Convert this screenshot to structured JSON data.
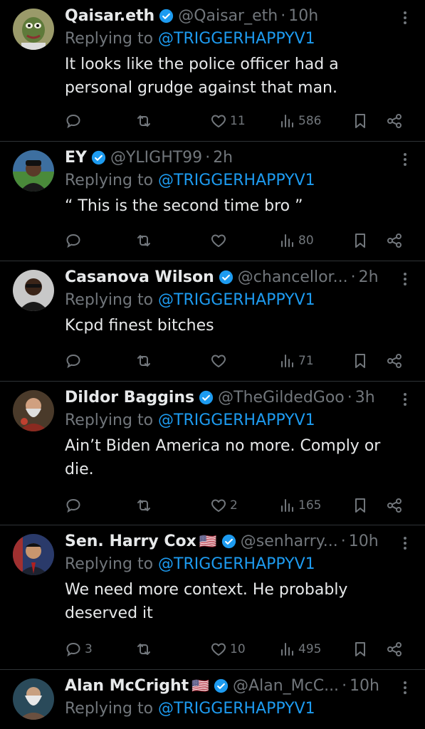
{
  "colors": {
    "background": "#000000",
    "text": "#e7e9ea",
    "muted": "#71767b",
    "accent": "#1d9bf0",
    "divider": "#2f3336"
  },
  "replying_prefix": "Replying to",
  "tweets": [
    {
      "name": "Qaisar.eth",
      "handle": "@Qaisar_eth",
      "time": "10h",
      "reply_to": "@TRIGGERHAPPYV1",
      "text": [
        "It looks like the police officer had a",
        "personal grudge against that man."
      ],
      "reply_count": "",
      "retweet_count": "",
      "like_count": "11",
      "view_count": "586",
      "avatar_icon": "pepe-avatar-icon"
    },
    {
      "name": "EY",
      "handle": "@YLIGHT99",
      "time": "2h",
      "reply_to": "@TRIGGERHAPPYV1",
      "text": [
        "“ This is the second time bro ”"
      ],
      "reply_count": "",
      "retweet_count": "",
      "like_count": "",
      "view_count": "80",
      "avatar_icon": "person-avatar-icon"
    },
    {
      "name": "Casanova Wilson",
      "handle": "@chancellor...",
      "time": "2h",
      "reply_to": "@TRIGGERHAPPYV1",
      "text": [
        "Kcpd finest bitches"
      ],
      "reply_count": "",
      "retweet_count": "",
      "like_count": "",
      "view_count": "71",
      "avatar_icon": "person-avatar-icon"
    },
    {
      "name": "Dildor Baggins",
      "handle": "@TheGildedGoo",
      "time": "3h",
      "reply_to": "@TRIGGERHAPPYV1",
      "text": [
        "Ain’t Biden America no more. Comply or",
        "die."
      ],
      "reply_count": "",
      "retweet_count": "",
      "like_count": "2",
      "view_count": "165",
      "avatar_icon": "wizard-avatar-icon"
    },
    {
      "name": "Sen. Harry Cox",
      "flag": "🇺🇸",
      "handle": "@senharry...",
      "time": "10h",
      "reply_to": "@TRIGGERHAPPYV1",
      "text": [
        "We need more context. He probably",
        "deserved it"
      ],
      "reply_count": "3",
      "retweet_count": "",
      "like_count": "10",
      "view_count": "495",
      "avatar_icon": "senator-avatar-icon"
    },
    {
      "name": "Alan McCright",
      "flag": "🇺🇸",
      "handle": "@Alan_McC...",
      "time": "10h",
      "reply_to": "@TRIGGERHAPPYV1",
      "text": [],
      "reply_count": "",
      "retweet_count": "",
      "like_count": "",
      "view_count": "",
      "avatar_icon": "wizard-avatar-icon"
    }
  ]
}
